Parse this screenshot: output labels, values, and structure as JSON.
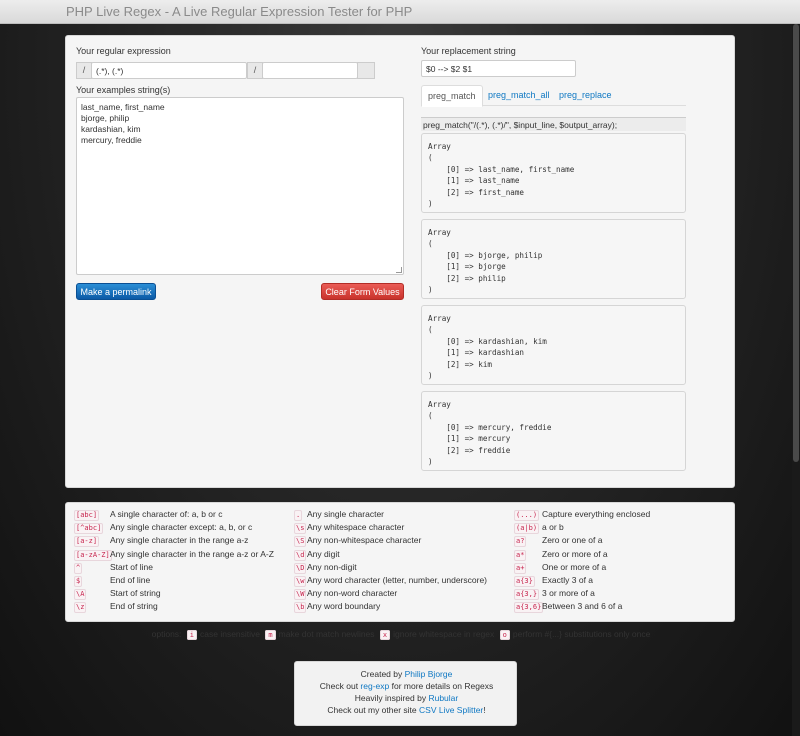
{
  "header": {
    "title": "PHP Live Regex - A Live Regular Expression Tester for PHP"
  },
  "form": {
    "regex_label": "Your regular expression",
    "delim_open": "/",
    "regex_value": "(.*), (.*)",
    "delim_close": "/",
    "flags_value": "",
    "examples_label": "Your examples string(s)",
    "examples_value": "last_name, first_name\nbjorge, philip\nkardashian, kim\nmercury, freddie",
    "replacement_label": "Your replacement string",
    "replacement_value": "$0 --> $2 $1",
    "permalink_button": "Make a permalink",
    "clear_button": "Clear Form Values"
  },
  "tabs": [
    {
      "label": "preg_match",
      "active": true
    },
    {
      "label": "preg_match_all",
      "active": false
    },
    {
      "label": "preg_replace",
      "active": false
    }
  ],
  "results": {
    "call": "preg_match(\"/(.*), (.*)/\", $input_line, $output_array);",
    "arrays": [
      "Array\n(\n    [0] => last_name, first_name\n    [1] => last_name\n    [2] => first_name\n)",
      "Array\n(\n    [0] => bjorge, philip\n    [1] => bjorge\n    [2] => philip\n)",
      "Array\n(\n    [0] => kardashian, kim\n    [1] => kardashian\n    [2] => kim\n)",
      "Array\n(\n    [0] => mercury, freddie\n    [1] => mercury\n    [2] => freddie\n)"
    ]
  },
  "reference": {
    "col1": [
      {
        "code": "[abc]",
        "desc": "A single character of: a, b or c"
      },
      {
        "code": "[^abc]",
        "desc": "Any single character except: a, b, or c"
      },
      {
        "code": "[a-z]",
        "desc": "Any single character in the range a-z"
      },
      {
        "code": "[a-zA-Z]",
        "desc": "Any single character in the range a-z or A-Z"
      },
      {
        "code": "^",
        "desc": "Start of line"
      },
      {
        "code": "$",
        "desc": "End of line"
      },
      {
        "code": "\\A",
        "desc": "Start of string"
      },
      {
        "code": "\\z",
        "desc": "End of string"
      }
    ],
    "col2": [
      {
        "code": ".",
        "desc": "Any single character"
      },
      {
        "code": "\\s",
        "desc": "Any whitespace character"
      },
      {
        "code": "\\S",
        "desc": "Any non-whitespace character"
      },
      {
        "code": "\\d",
        "desc": "Any digit"
      },
      {
        "code": "\\D",
        "desc": "Any non-digit"
      },
      {
        "code": "\\w",
        "desc": "Any word character (letter, number, underscore)"
      },
      {
        "code": "\\W",
        "desc": "Any non-word character"
      },
      {
        "code": "\\b",
        "desc": "Any word boundary"
      }
    ],
    "col3": [
      {
        "code": "(...)",
        "desc": "Capture everything enclosed"
      },
      {
        "code": "(a|b)",
        "desc": "a or b"
      },
      {
        "code": "a?",
        "desc": "Zero or one of a"
      },
      {
        "code": "a*",
        "desc": "Zero or more of a"
      },
      {
        "code": "a+",
        "desc": "One or more of a"
      },
      {
        "code": "a{3}",
        "desc": "Exactly 3 of a"
      },
      {
        "code": "a{3,}",
        "desc": "3 or more of a"
      },
      {
        "code": "a{3,6}",
        "desc": "Between 3 and 6 of a"
      }
    ],
    "options": {
      "prefix": "options:",
      "items": [
        {
          "code": "i",
          "desc": "case insensitive"
        },
        {
          "code": "m",
          "desc": "make dot match newlines"
        },
        {
          "code": "x",
          "desc": "ignore whitespace in regex"
        },
        {
          "code": "o",
          "desc": "perform #{...} substitutions only once"
        }
      ]
    }
  },
  "footer": {
    "line1_prefix": "Created by ",
    "line1_link": "Philip Bjorge",
    "line2_prefix": "Check out ",
    "line2_link": "reg-exp",
    "line2_suffix": " for more details on Regexs",
    "line3_prefix": "Heavily inspired by ",
    "line3_link": "Rubular",
    "line4_prefix": "Check out my other site ",
    "line4_link": "CSV Live Splitter",
    "line4_suffix": "!"
  }
}
